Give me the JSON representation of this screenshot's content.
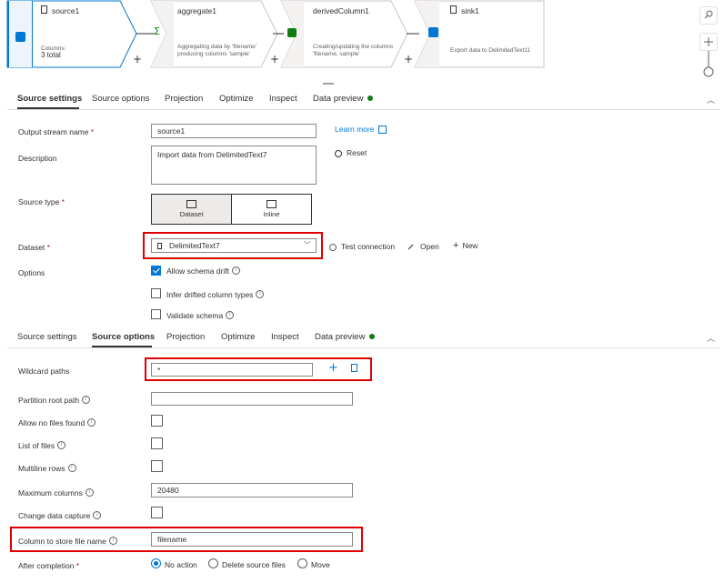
{
  "pipeline": {
    "nodes": [
      {
        "title": "source1",
        "desc_line1": "Columns:",
        "desc_line2": "3 total"
      },
      {
        "title": "aggregate1",
        "desc_line1": "Aggregating data by 'filename'",
        "desc_line2": "producing columns 'sample'"
      },
      {
        "title": "derivedColumn1",
        "desc_line1": "Creating/updating the columns",
        "desc_line2": "'filename, sample'"
      },
      {
        "title": "sink1",
        "desc_line1": "Export data to DelimitedText11",
        "desc_line2": ""
      }
    ],
    "plus": "+"
  },
  "tabs1": {
    "items": [
      "Source settings",
      "Source options",
      "Projection",
      "Optimize",
      "Inspect",
      "Data preview"
    ]
  },
  "tabs2": {
    "items": [
      "Source settings",
      "Source options",
      "Projection",
      "Optimize",
      "Inspect",
      "Data preview"
    ]
  },
  "source_settings": {
    "output_stream_label": "Output stream name",
    "output_stream_value": "source1",
    "learn_more": "Learn more",
    "description_label": "Description",
    "description_value": "Import data from DelimitedText7",
    "reset": "Reset",
    "source_type_label": "Source type",
    "source_type_dataset": "Dataset",
    "source_type_inline": "Inline",
    "dataset_label": "Dataset",
    "dataset_value": "DelimitedText7",
    "test_connection": "Test connection",
    "open": "Open",
    "new": "New",
    "options_label": "Options",
    "allow_schema_drift": "Allow schema drift",
    "infer_drifted": "Infer drifted column types",
    "validate_schema": "Validate schema",
    "required_mark": "*"
  },
  "source_options": {
    "wildcard_label": "Wildcard paths",
    "wildcard_value": "*",
    "partition_label": "Partition root path",
    "allow_no_files_label": "Allow no files found",
    "list_of_files_label": "List of files",
    "multiline_label": "Multiline rows",
    "max_columns_label": "Maximum columns",
    "max_columns_value": "20480",
    "cdc_label": "Change data capture",
    "column_store_label": "Column to store file name",
    "column_store_value": "filename",
    "after_completion_label": "After completion",
    "after_options": [
      "No action",
      "Delete source files",
      "Move"
    ],
    "required_mark": "*"
  },
  "colors": {
    "accent": "#0078d4",
    "highlight": "#e00000",
    "status_green": "#107c10"
  }
}
